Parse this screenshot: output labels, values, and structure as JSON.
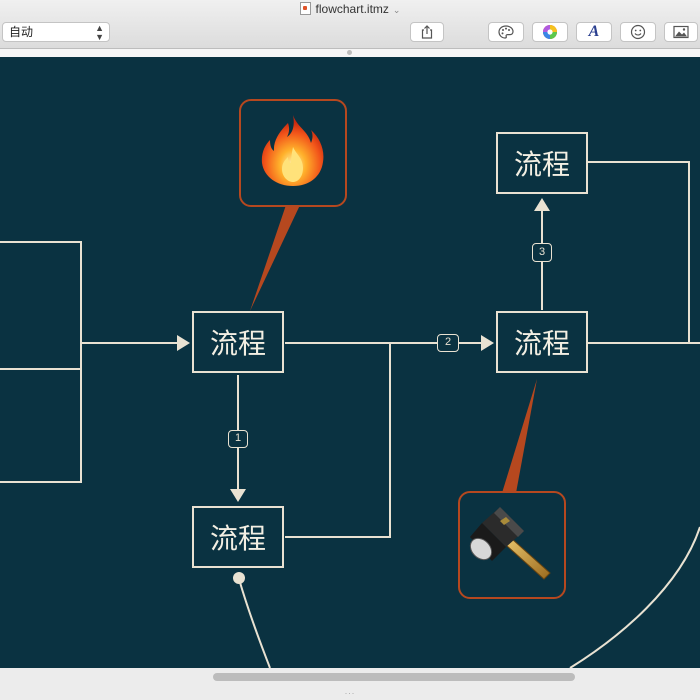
{
  "window": {
    "title": "flowchart.itmz",
    "title_chevron": "⌄"
  },
  "toolbar": {
    "zoom_select": {
      "value": "自动"
    },
    "buttons": [
      {
        "name": "share-icon"
      },
      {
        "name": "palette-icon"
      },
      {
        "name": "color-wheel-icon"
      },
      {
        "name": "font-icon",
        "label": "A"
      },
      {
        "name": "emoji-icon"
      },
      {
        "name": "image-icon"
      }
    ]
  },
  "diagram": {
    "background": "#0a3241",
    "stroke_color": "#e9e2d2",
    "callout_color": "#b6481f",
    "nodes": [
      {
        "id": "left",
        "label": "流程"
      },
      {
        "id": "down",
        "label": "流程"
      },
      {
        "id": "right",
        "label": "流程"
      },
      {
        "id": "top",
        "label": "流程"
      }
    ],
    "edge_labels": {
      "e1": "1",
      "e2": "2",
      "e3": "3"
    },
    "callouts": [
      {
        "id": "fire",
        "icon": "fire-icon"
      },
      {
        "id": "hammer",
        "icon": "hammer-icon"
      }
    ]
  },
  "statusbar": {
    "dots": "..."
  }
}
